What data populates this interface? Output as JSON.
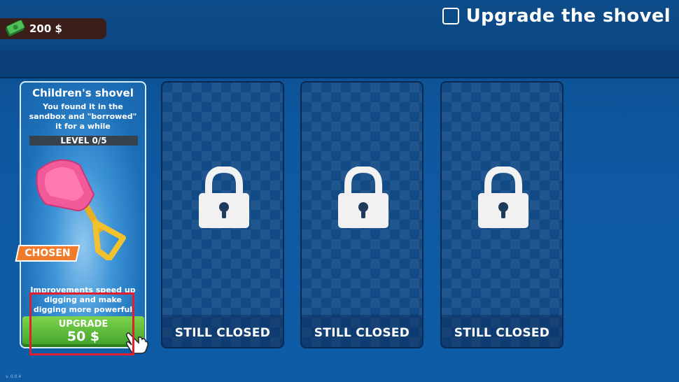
{
  "header": {
    "currency_amount": "200 $",
    "currency_icon": "cash-icon",
    "title": "Upgrade the shovel"
  },
  "cards": {
    "active": {
      "title": "Children's shovel",
      "description": "You found it in the sandbox and \"borrowed\" it for a while",
      "level": "LEVEL 0/5",
      "badge": "CHOSEN",
      "improvement_text": "Improvements speed up digging and make digging more powerful",
      "upgrade_label": "UPGRADE",
      "upgrade_price": "50 $"
    },
    "locked": [
      {
        "label": "STILL CLOSED"
      },
      {
        "label": "STILL CLOSED"
      },
      {
        "label": "STILL CLOSED"
      }
    ]
  },
  "footer": {
    "version": "v. 0.0.4"
  },
  "colors": {
    "upgrade_button": "#4caf30",
    "chosen_badge": "#f07b2a",
    "highlight_box": "#e01e2e",
    "background": "#0e58a0"
  }
}
